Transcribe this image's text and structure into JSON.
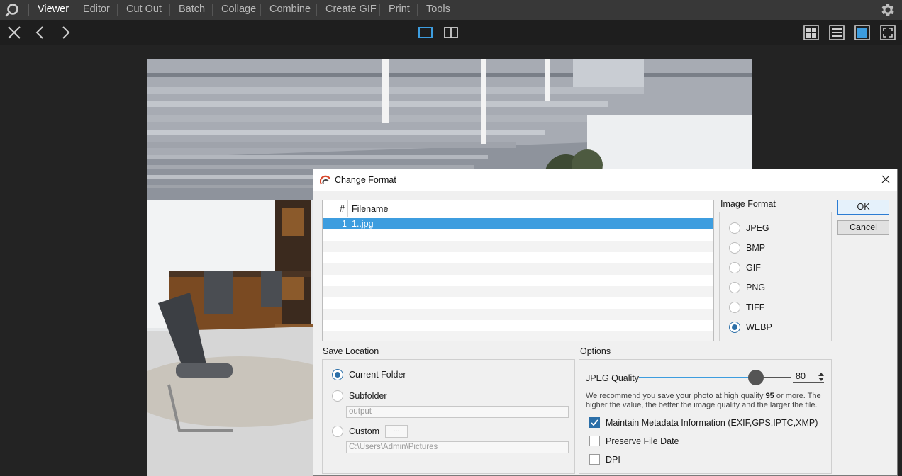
{
  "menu": {
    "items": [
      {
        "label": "Viewer",
        "active": true
      },
      {
        "label": "Editor"
      },
      {
        "label": "Cut Out"
      },
      {
        "label": "Batch"
      },
      {
        "label": "Collage"
      },
      {
        "label": "Combine"
      },
      {
        "label": "Create GIF"
      },
      {
        "label": "Print"
      },
      {
        "label": "Tools"
      }
    ]
  },
  "toolbar": {
    "left_icons": [
      "close-icon",
      "arrow-left-icon",
      "arrow-right-icon"
    ],
    "center_icons": [
      "single-view-icon",
      "compare-view-icon"
    ],
    "right_icons": [
      "grid-view-icon",
      "list-view-icon",
      "single-page-view-icon",
      "fullscreen-icon"
    ]
  },
  "dialog": {
    "title": "Change Format",
    "file_list": {
      "col_num": "#",
      "col_name": "Filename",
      "rows": [
        {
          "num": "1",
          "name": "1..jpg"
        }
      ]
    },
    "image_format": {
      "label": "Image Format",
      "options": [
        "JPEG",
        "BMP",
        "GIF",
        "PNG",
        "TIFF",
        "WEBP"
      ],
      "selected": "WEBP"
    },
    "ok_label": "OK",
    "cancel_label": "Cancel",
    "save_location": {
      "label": "Save Location",
      "current_folder": "Current Folder",
      "subfolder": "Subfolder",
      "subfolder_value": "output",
      "custom": "Custom",
      "browse": "...",
      "custom_path": "C:\\Users\\Admin\\Pictures",
      "selected": "Current Folder"
    },
    "options": {
      "label": "Options",
      "jpeg_quality_label": "JPEG Quality",
      "jpeg_quality": 80,
      "jpeg_quality_max": 100,
      "note_part1": "We recommend you save your photo at high quality",
      "note_bold": "95",
      "note_part2": "or more. The higher the value, the better the image quality and the larger the file.",
      "maintain_metadata": "Maintain Metadata Information (EXIF,GPS,IPTC,XMP)",
      "maintain_metadata_checked": true,
      "preserve_date": "Preserve File Date",
      "preserve_date_checked": false,
      "dpi": "DPI",
      "dpi_checked": false
    }
  },
  "colors": {
    "accent": "#3d9ddf",
    "radio_selected": "#2b6fa8",
    "menu_bg": "#383838",
    "toolbar_bg": "#1e1e1e"
  }
}
